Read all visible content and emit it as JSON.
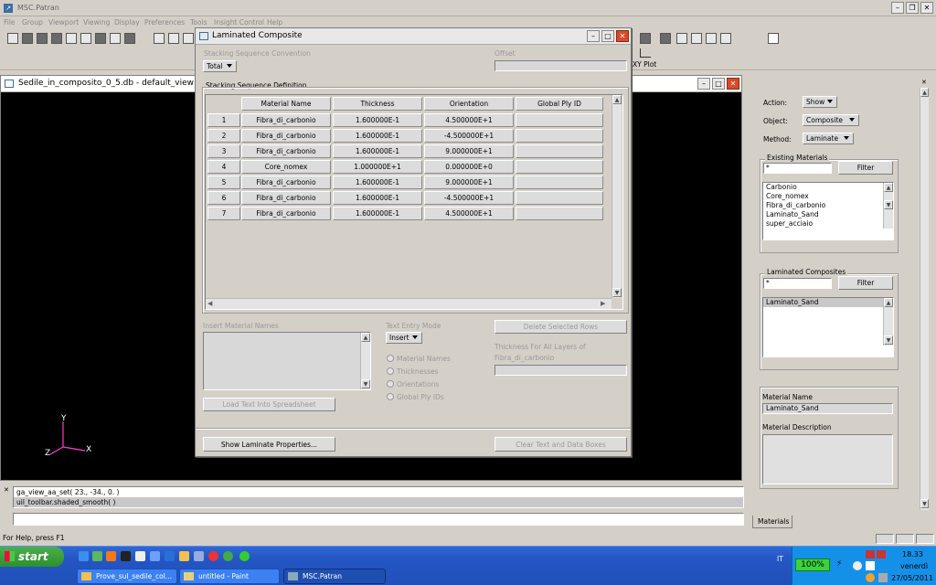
{
  "app": {
    "title": "MSC.Patran",
    "menu": [
      "File",
      "Group",
      "Viewport",
      "Viewing",
      "Display",
      "Preferences",
      "Tools",
      "Insight Control",
      "Help"
    ],
    "xyplot_label": "XY Plot"
  },
  "viewport": {
    "title": "Sedile_in_composito_0_5.db - default_view",
    "axes": {
      "y": "Y",
      "x": "X",
      "z": "Z"
    }
  },
  "command": {
    "history": [
      "ga_view_aa_set( 23., -34., 0. )",
      "uil_toolbar.shaded_smooth(  )"
    ],
    "input_value": ""
  },
  "status_text": "For Help, press F1",
  "dialog": {
    "title": "Laminated Composite",
    "stacking_convention_label": "Stacking Sequence Convention",
    "stacking_convention_value": "Total",
    "offset_label": "Offset",
    "offset_value": "",
    "stacking_definition_label": "Stacking Sequence Definition",
    "columns": [
      "Material Name",
      "Thickness",
      "Orientation",
      "Global Ply ID"
    ],
    "rows": [
      {
        "n": "1",
        "material": "Fibra_di_carbonio",
        "thickness": "1.600000E-1",
        "orientation": "4.500000E+1",
        "ply": ""
      },
      {
        "n": "2",
        "material": "Fibra_di_carbonio",
        "thickness": "1.600000E-1",
        "orientation": "-4.500000E+1",
        "ply": ""
      },
      {
        "n": "3",
        "material": "Fibra_di_carbonio",
        "thickness": "1.600000E-1",
        "orientation": "9.000000E+1",
        "ply": ""
      },
      {
        "n": "4",
        "material": "Core_nomex",
        "thickness": "1.000000E+1",
        "orientation": "0.000000E+0",
        "ply": ""
      },
      {
        "n": "5",
        "material": "Fibra_di_carbonio",
        "thickness": "1.600000E-1",
        "orientation": "9.000000E+1",
        "ply": ""
      },
      {
        "n": "6",
        "material": "Fibra_di_carbonio",
        "thickness": "1.600000E-1",
        "orientation": "-4.500000E+1",
        "ply": ""
      },
      {
        "n": "7",
        "material": "Fibra_di_carbonio",
        "thickness": "1.600000E-1",
        "orientation": "4.500000E+1",
        "ply": ""
      }
    ],
    "insert_material_names_label": "Insert Material Names",
    "text_entry_mode_label": "Text Entry Mode",
    "text_entry_mode_value": "Insert",
    "radio_options": [
      "Material Names",
      "Thicknesses",
      "Orientations",
      "Global Ply IDs"
    ],
    "delete_rows_button": "Delete Selected Rows",
    "thickness_all_label_1": "Thickness For All Layers of",
    "thickness_all_label_2": "Fibra_di_carbonio",
    "load_text_button": "Load Text Into Spreadsheet",
    "show_laminate_button": "Show Laminate Properties...",
    "clear_text_button": "Clear Text and Data Boxes"
  },
  "panel": {
    "action_label": "Action:",
    "action_value": "Show",
    "object_label": "Object:",
    "object_value": "Composite",
    "method_label": "Method:",
    "method_value": "Laminate",
    "existing_materials_label": "Existing Materials",
    "filter1_value": "*",
    "filter_button": "Filter",
    "existing_materials": [
      "Carbonio",
      "Core_nomex",
      "Fibra_di_carbonio",
      "Laminato_Sand",
      "super_acciaio"
    ],
    "laminated_composites_label": "Laminated Composites",
    "filter2_value": "*",
    "laminated_composites": [
      "Laminato_Sand"
    ],
    "material_name_label": "Material Name",
    "material_name_value": "Laminato_Sand",
    "material_description_label": "Material Description",
    "tab_label": "Materials"
  },
  "taskbar": {
    "start_label": "start",
    "tasks": [
      "Prove_sul_sedile_col...",
      "untitled - Paint",
      "MSC.Patran"
    ],
    "language": "IT",
    "battery": "100%",
    "time": "18.33",
    "day": "venerdì",
    "date": "27/05/2011"
  }
}
